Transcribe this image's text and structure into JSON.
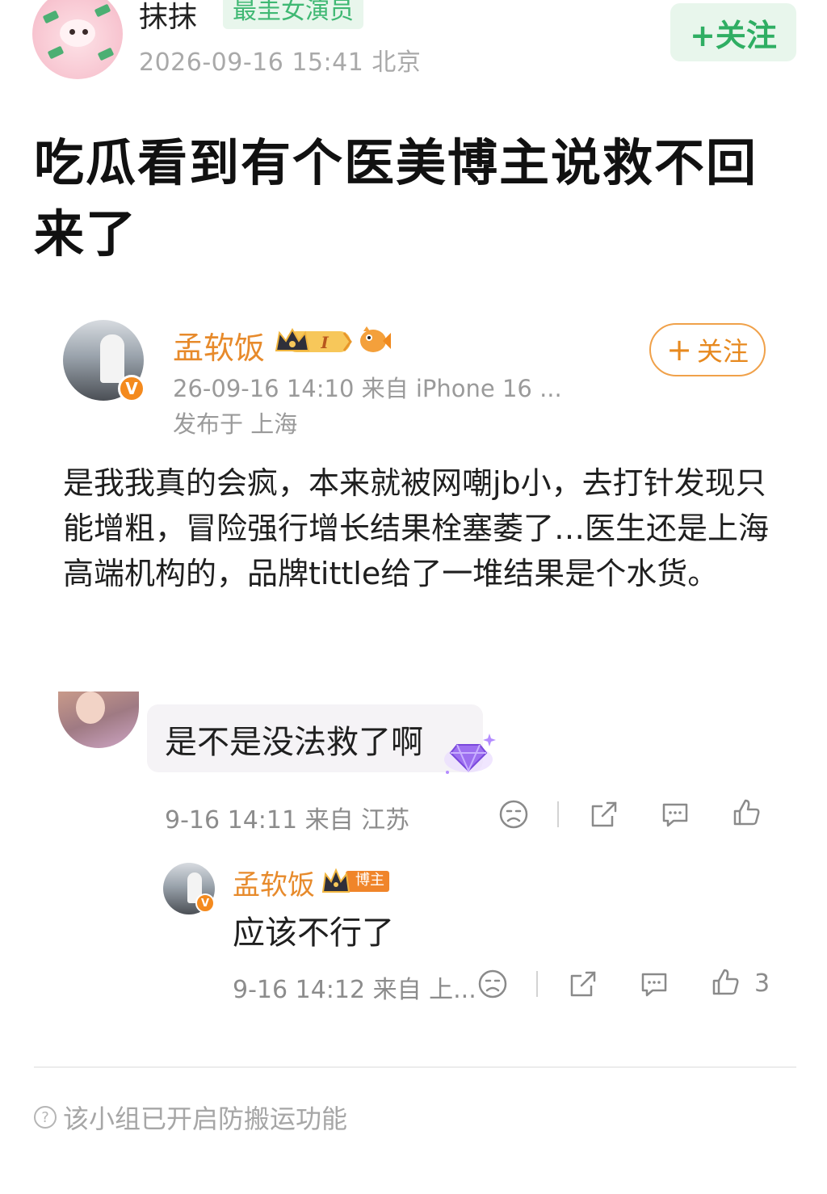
{
  "post": {
    "author": "抹抹",
    "tag": "最圭女演员",
    "time_location": "2026-09-16 15:41  北京",
    "follow_label": "+关注",
    "title": "吃瓜看到有个医美博主说救不回来了"
  },
  "embedded": {
    "author": "孟软饭",
    "level_badge": "I",
    "verified_mark": "V",
    "meta_line1": "26-09-16 14:10  来自 iPhone 16 ...",
    "meta_line2": "发布于 上海",
    "follow_label": "关注",
    "body": "是我我真的会疯，本来就被网嘲jb小，去打针发现只能增粗，冒险强行增长结果栓塞萎了…医生还是上海高端机构的，品牌tittle给了一堆结果是个水货。"
  },
  "comment": {
    "text": "是不是没法救了啊",
    "meta": "9-16 14:11  来自 江苏"
  },
  "reply": {
    "author": "孟软饭",
    "badge": "博主",
    "text": "应该不行了",
    "meta": "9-16 14:12  来自 上...",
    "likes": "3"
  },
  "footer": {
    "note": "该小组已开启防搬运功能"
  },
  "colors": {
    "green_accent": "#2fae63",
    "orange_accent": "#e7891f",
    "muted_text": "#9a9a9a"
  },
  "icons": [
    "help-icon",
    "sad-face-icon",
    "share-icon",
    "comment-icon",
    "like-icon",
    "crown-badge-icon",
    "fish-icon",
    "gem-icon",
    "verified-icon"
  ]
}
